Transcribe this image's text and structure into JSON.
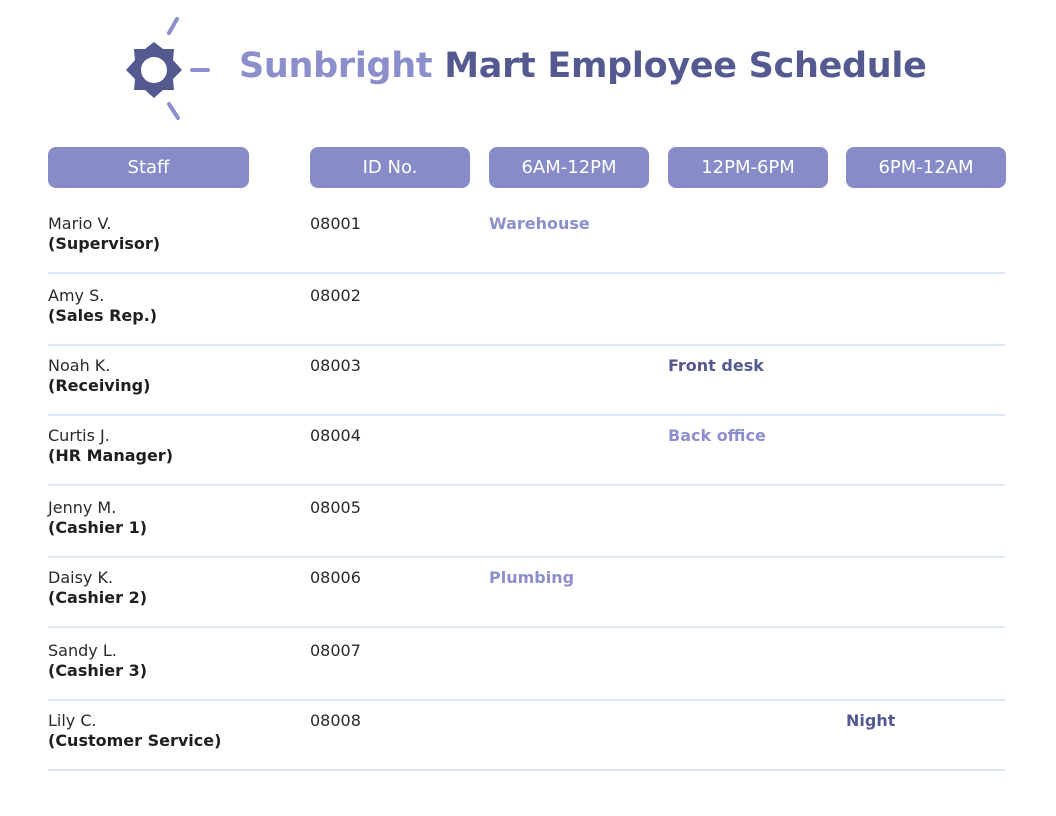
{
  "header": {
    "title_accent": "Sunbright",
    "title_main": "Mart Employee Schedule"
  },
  "columns": [
    "Staff",
    "ID No.",
    "6AM-12PM",
    "12PM-6PM",
    "6PM-12AM"
  ],
  "rows": [
    {
      "name": "Mario V.",
      "role": "(Supervisor)",
      "id": "08001",
      "shift": "Warehouse",
      "shift_column": 1
    },
    {
      "name": "Amy S.",
      "role": "(Sales Rep.)",
      "id": "08002",
      "shift": "",
      "shift_column": 0
    },
    {
      "name": "Noah K.",
      "role": "(Receiving)",
      "id": "08003",
      "shift": "Front desk",
      "shift_column": 2
    },
    {
      "name": "Curtis J.",
      "role": "(HR Manager)",
      "id": "08004",
      "shift": "Back office",
      "shift_column": 2
    },
    {
      "name": "Jenny M.",
      "role": "(Cashier 1)",
      "id": "08005",
      "shift": "",
      "shift_column": 0
    },
    {
      "name": "Daisy K.",
      "role": "(Cashier 2)",
      "id": "08006",
      "shift": "Plumbing",
      "shift_column": 1
    },
    {
      "name": "Sandy L.",
      "role": "(Cashier 3)",
      "id": "08007",
      "shift": "",
      "shift_column": 0
    },
    {
      "name": "Lily C.",
      "role": "(Customer Service)",
      "id": "08008",
      "shift": "Night",
      "shift_column": 3
    }
  ],
  "colors": {
    "accent": "#8c8fcc",
    "dark": "#545a8f",
    "header_bg": "#878cc9",
    "divider": "#dfe6f4"
  },
  "icons": {
    "logo": "sun-icon"
  }
}
